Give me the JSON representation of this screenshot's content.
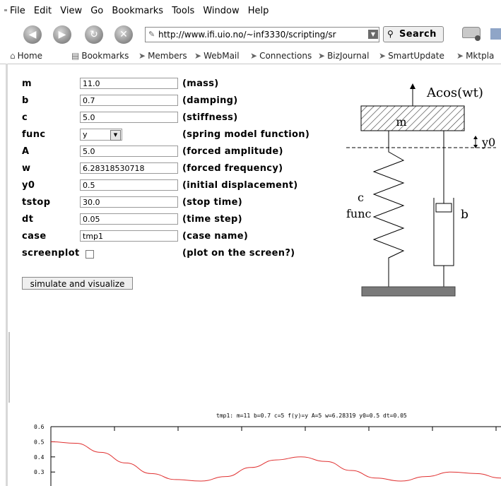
{
  "menubar": {
    "items": [
      "File",
      "Edit",
      "View",
      "Go",
      "Bookmarks",
      "Tools",
      "Window",
      "Help"
    ]
  },
  "navbar": {
    "url": "http://www.ifi.uio.no/~inf3330/scripting/sr",
    "search_label": "Search"
  },
  "bookmarks": {
    "items": [
      "Home",
      "Bookmarks",
      "Members",
      "WebMail",
      "Connections",
      "BizJournal",
      "SmartUpdate",
      "Mktpla"
    ]
  },
  "form": {
    "rows": [
      {
        "label": "m",
        "value": "11.0",
        "desc": "(mass)"
      },
      {
        "label": "b",
        "value": "0.7",
        "desc": "(damping)"
      },
      {
        "label": "c",
        "value": "5.0",
        "desc": "(stiffness)"
      },
      {
        "label": "func",
        "value": "y",
        "desc": "(spring model function)"
      },
      {
        "label": "A",
        "value": "5.0",
        "desc": "(forced amplitude)"
      },
      {
        "label": "w",
        "value": "6.28318530718",
        "desc": "(forced frequency)"
      },
      {
        "label": "y0",
        "value": "0.5",
        "desc": "(initial displacement)"
      },
      {
        "label": "tstop",
        "value": "30.0",
        "desc": "(stop time)"
      },
      {
        "label": "dt",
        "value": "0.05",
        "desc": "(time step)"
      },
      {
        "label": "case",
        "value": "tmp1",
        "desc": "(case name)"
      },
      {
        "label": "screenplot",
        "value": "",
        "desc": "(plot on the screen?)"
      }
    ],
    "simulate_label": "simulate and visualize"
  },
  "diagram": {
    "force_label": "Acos(wt)",
    "mass_label": "m",
    "y0_label": "y0",
    "c_label": "c",
    "func_label": "func",
    "b_label": "b"
  },
  "plot": {
    "title": "tmp1: m=11 b=0.7 c=5 f(y)=y A=5 w=6.28319 y0=0.5 dt=0.05",
    "yticks": [
      "0.6",
      "0.5",
      "0.4",
      "0.3"
    ]
  },
  "chart_data": {
    "type": "line",
    "title": "tmp1: m=11 b=0.7 c=5 f(y)=y A=5 w=6.28319 y0=0.5 dt=0.05",
    "ylim": [
      0.25,
      0.6
    ],
    "series": [
      {
        "values": [
          0.5,
          0.49,
          0.43,
          0.36,
          0.29,
          0.25,
          0.24,
          0.27,
          0.33,
          0.38,
          0.4,
          0.37,
          0.31,
          0.26,
          0.24,
          0.27,
          0.3,
          0.29,
          0.26
        ]
      }
    ]
  }
}
